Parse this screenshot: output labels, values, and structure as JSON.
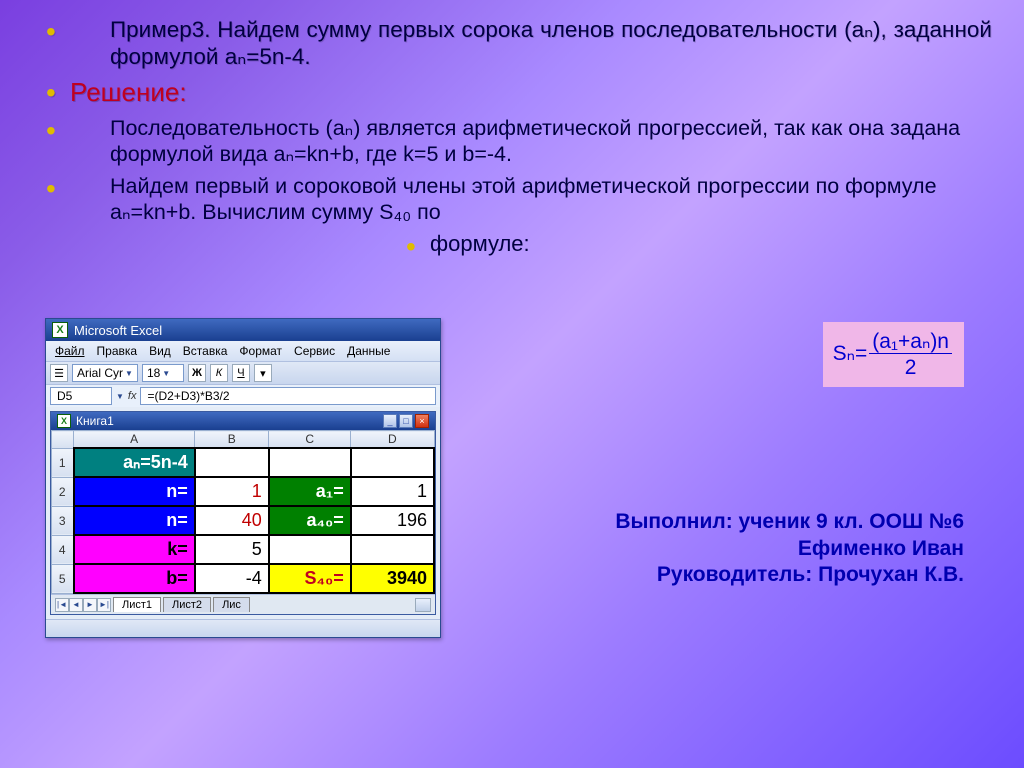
{
  "bullets": {
    "b1": "Пример3. Найдем сумму первых сорока членов последовательности (aₙ), заданной формулой aₙ=5n-4.",
    "b2": "Решение:",
    "b3": "Последовательность (aₙ) является арифметической прогрессией, так как она задана формулой вида aₙ=kn+b, где k=5 и b=-4.",
    "b4": "Найдем первый и сороковой члены этой арифметической прогрессии по формуле aₙ=kn+b. Вычислим сумму S₄₀ по",
    "b5": "формуле:"
  },
  "formula": {
    "lhs": "Sₙ=",
    "num": "(a₁+aₙ)n",
    "den": "2"
  },
  "credits": {
    "l1": "Выполнил: ученик 9 кл. ООШ №6",
    "l2": "Ефименко Иван",
    "l3": "Руководитель: Прочухан К.В."
  },
  "excel": {
    "title": "Microsoft Excel",
    "menu": [
      "Файл",
      "Правка",
      "Вид",
      "Вставка",
      "Формат",
      "Сервис",
      "Данные"
    ],
    "font": "Arial Cyr",
    "fontsize": "18",
    "bold": "Ж",
    "italic": "К",
    "under": "Ч",
    "namebox": "D5",
    "fx": "=(D2+D3)*B3/2",
    "book": "Книга1",
    "cols": [
      "A",
      "B",
      "C",
      "D"
    ],
    "rows": {
      "r1": {
        "A": "aₙ=5n-4"
      },
      "r2": {
        "A": "n=",
        "B": "1",
        "C": "a₁=",
        "D": "1"
      },
      "r3": {
        "A": "n=",
        "B": "40",
        "C": "a₄₀=",
        "D": "196"
      },
      "r4": {
        "A": "k=",
        "B": "5"
      },
      "r5": {
        "A": "b=",
        "B": "-4",
        "C": "S₄₀=",
        "D": "3940"
      }
    },
    "tabs": [
      "Лист1",
      "Лист2",
      "Лис"
    ]
  }
}
